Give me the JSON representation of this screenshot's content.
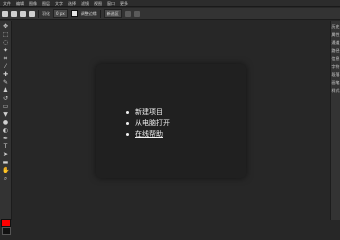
{
  "menubar": [
    "文件",
    "编辑",
    "图像",
    "图层",
    "文字",
    "选择",
    "滤镜",
    "视图",
    "窗口",
    "更多"
  ],
  "options": {
    "feather_label": "羽化",
    "feather_value": "0 px",
    "refine_edge_label": "调整边缘",
    "mode_value": "新选区"
  },
  "right_panel": [
    "历史",
    "属性",
    "通道",
    "路径",
    "信息",
    "字符",
    "段落",
    "画笔",
    "样式"
  ],
  "colors": {
    "foreground": "#ff0000",
    "background": "#111111",
    "accent": "#2a2a2a"
  },
  "start_menu": {
    "items": [
      "新建项目",
      "从电脑打开",
      "在线帮助"
    ]
  }
}
